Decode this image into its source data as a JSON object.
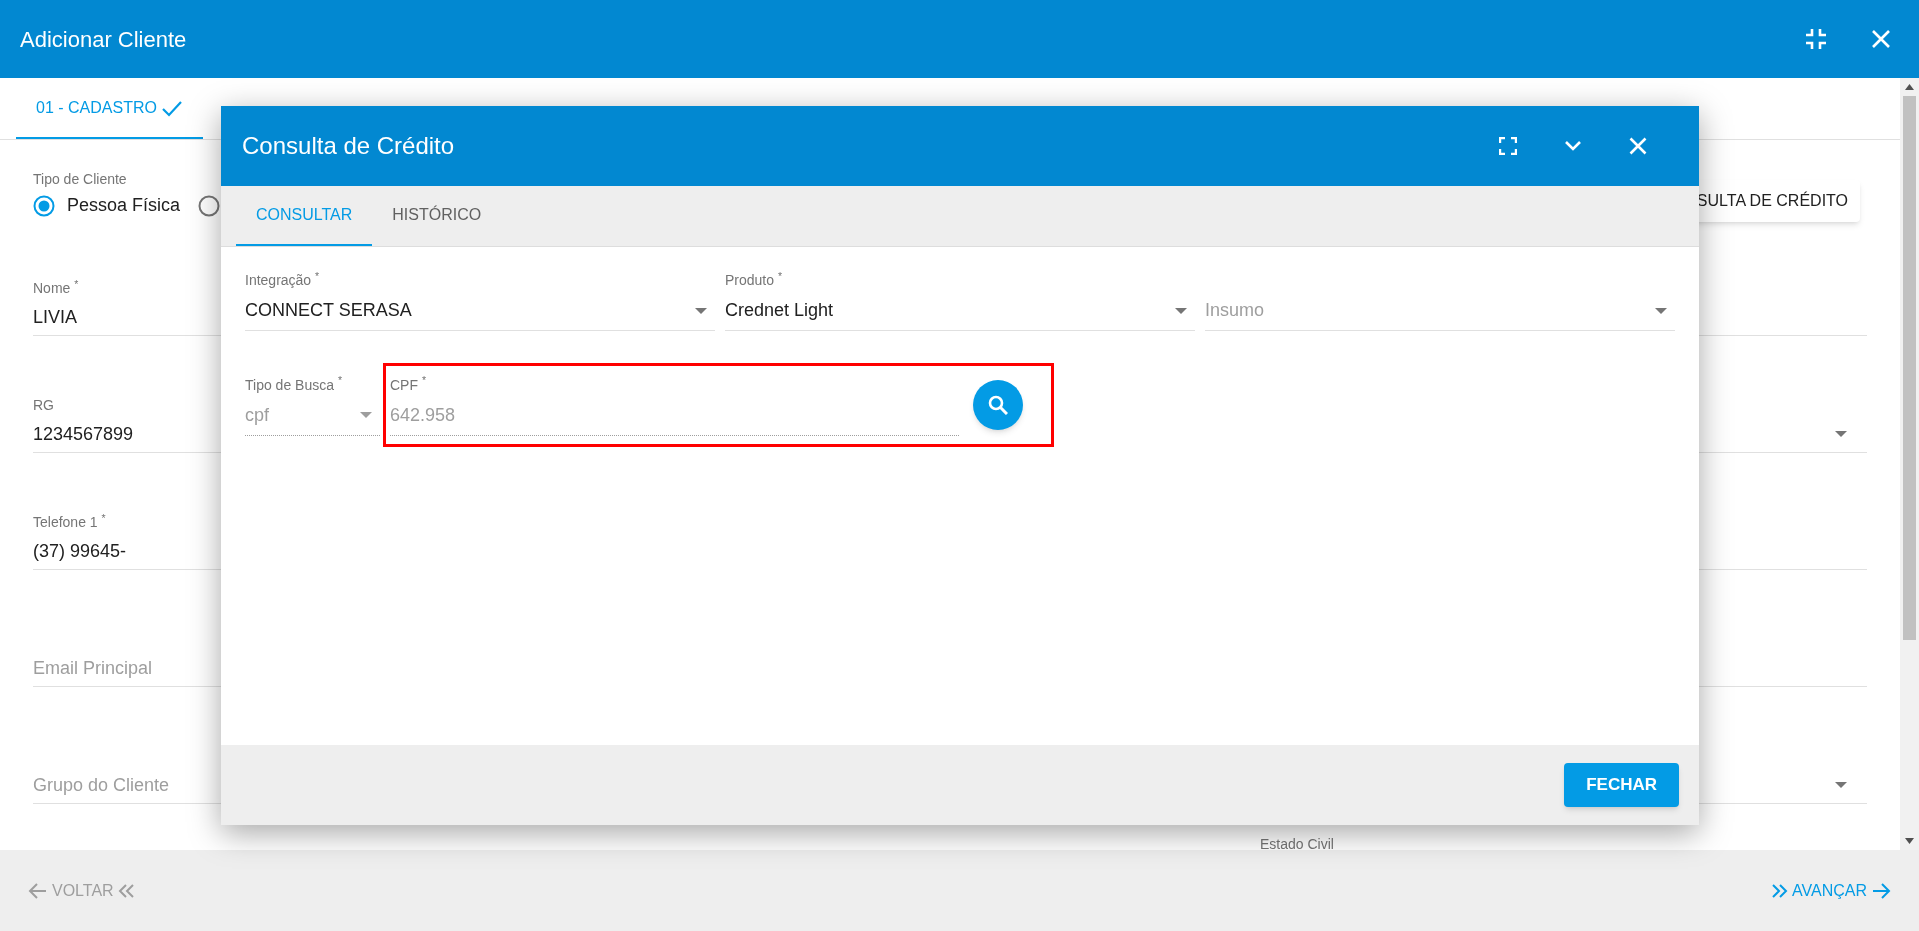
{
  "window": {
    "title": "Adicionar Cliente"
  },
  "steps": [
    {
      "label": "01 - CADASTRO",
      "selected": true
    }
  ],
  "client_type": {
    "label": "Tipo de Cliente",
    "options": [
      {
        "label": "Pessoa Física",
        "selected": true
      },
      {
        "selected": false
      }
    ]
  },
  "credit_button": "SULTA DE CRÉDITO",
  "fields": [
    {
      "label": "Nome $^{*}$",
      "value": "LIVIA",
      "trailing_caret": false
    },
    {
      "label": "RG",
      "value": "1234567899",
      "trailing_caret": true
    },
    {
      "label": "Telefone 1 $^{*}$",
      "value": "(37) 99645-",
      "trailing_caret": false
    },
    {
      "placeholder": "Email Principal",
      "trailing_caret": false
    },
    {
      "placeholder": "Grupo do Cliente",
      "trailing_caret": true
    }
  ],
  "estado_civil_label": "Estado Civil",
  "nav": {
    "back": "VOLTAR",
    "next": "AVANÇAR"
  },
  "dialog": {
    "title": "Consulta de Crédito",
    "tabs": [
      {
        "label": "CONSULTAR",
        "selected": true
      },
      {
        "label": "HISTÓRICO",
        "selected": false
      }
    ],
    "selects": [
      {
        "label": "Integração $^{*}$",
        "value": "CONNECT SERASA"
      },
      {
        "label": "Produto $^{*}$",
        "value": "Crednet Light"
      },
      {
        "placeholder": "Insumo"
      }
    ],
    "search_type": {
      "label": "Tipo de Busca $^{*}$",
      "value": "cpf",
      "disabled": true
    },
    "cpf": {
      "label": "CPF $^{*}$",
      "value": "642.958",
      "disabled": true,
      "highlighted": true
    },
    "close_button": "FECHAR"
  }
}
